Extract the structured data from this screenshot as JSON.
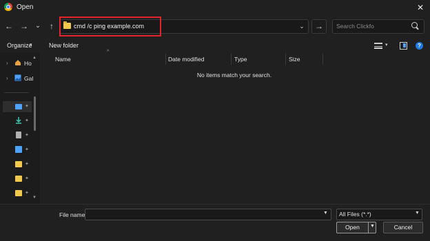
{
  "window": {
    "title": "Open",
    "close_glyph": "✕",
    "icon": "chrome-icon"
  },
  "nav": {
    "back_glyph": "←",
    "forward_glyph": "→",
    "recent_glyph": "⌄",
    "up_glyph": "↑",
    "address": "cmd /c ping example.com",
    "address_dropdown_glyph": "⌄",
    "go_glyph": "→",
    "search_placeholder": "Search Clickfo"
  },
  "command_bar": {
    "organize": "Organize",
    "organize_chevron": "▾",
    "new_folder": "New folder",
    "view_chevron": "▾",
    "help": "?"
  },
  "sidebar": {
    "items": [
      {
        "label": "Ho",
        "icon": "home-icon",
        "color": "#e8a040"
      },
      {
        "label": "Gal",
        "icon": "gallery-icon",
        "color": "#4da3ff"
      }
    ],
    "quick_access": [
      {
        "icon": "desktop-icon",
        "color": "#4da3ff"
      },
      {
        "icon": "downloads-icon",
        "color": "#3cc8b4"
      },
      {
        "icon": "documents-icon",
        "color": "#b0b0b0"
      },
      {
        "icon": "pictures-icon",
        "color": "#4da3ff"
      },
      {
        "icon": "folder-icon",
        "color": "#f2c94c"
      },
      {
        "icon": "folder-icon",
        "color": "#f2c94c"
      },
      {
        "icon": "folder-icon",
        "color": "#f2c94c"
      }
    ],
    "pin_glyph": "📌",
    "expand_glyph": "›"
  },
  "columns": [
    "Name",
    "Date modified",
    "Type",
    "Size"
  ],
  "empty_message": "No items match your search.",
  "bottom": {
    "filename_label": "File name:",
    "filename_value": "",
    "filetype": "All Files (*.*)",
    "open": "Open",
    "cancel": "Cancel"
  },
  "colors": {
    "highlight": "#e3242b",
    "background": "#202020",
    "accent": "#1f7ae0"
  }
}
